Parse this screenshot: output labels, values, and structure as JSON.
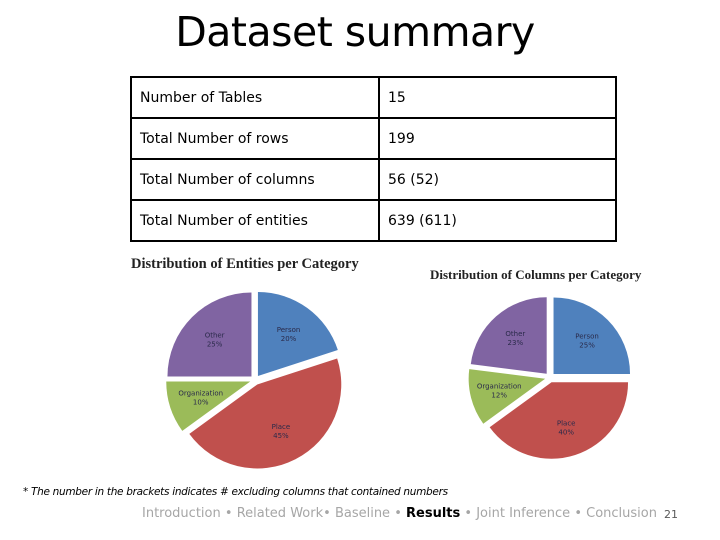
{
  "slide": {
    "title": "Dataset summary",
    "page_number": "21"
  },
  "summary_table": {
    "rows": [
      {
        "label": "Number of Tables",
        "value": "15"
      },
      {
        "label": "Total Number of rows",
        "value": "199"
      },
      {
        "label": "Total Number of columns",
        "value": "56 (52)"
      },
      {
        "label": "Total Number of entities",
        "value": "639 (611)"
      }
    ]
  },
  "footnote": "* The number in the brackets indicates # excluding columns  that contained numbers",
  "nav": {
    "items": [
      {
        "label": "Introduction",
        "active": false
      },
      {
        "label": "Related Work",
        "active": false
      },
      {
        "label": "Baseline",
        "active": false
      },
      {
        "label": "Results",
        "active": true
      },
      {
        "label": "Joint Inference",
        "active": false
      },
      {
        "label": "Conclusion",
        "active": false
      }
    ],
    "separator": "•"
  },
  "colors": {
    "person": "#4f81bd",
    "place": "#c0504d",
    "organization": "#9bbb59",
    "other": "#8064a2"
  },
  "chart_data": [
    {
      "type": "pie",
      "title": "Distribution of Entities per Category",
      "categories": [
        "Person",
        "Place",
        "Organization",
        "Other"
      ],
      "values": [
        20,
        45,
        10,
        25
      ],
      "labels": [
        "20%",
        "45%",
        "10%",
        "25%"
      ],
      "exploded": true,
      "legend": "none"
    },
    {
      "type": "pie",
      "title": "Distribution of Columns per Category",
      "categories": [
        "Person",
        "Place",
        "Organization",
        "Other"
      ],
      "values": [
        25,
        40,
        12,
        23
      ],
      "labels": [
        "25%",
        "40%",
        "12%",
        "23%"
      ],
      "exploded": true,
      "legend": "none"
    }
  ]
}
